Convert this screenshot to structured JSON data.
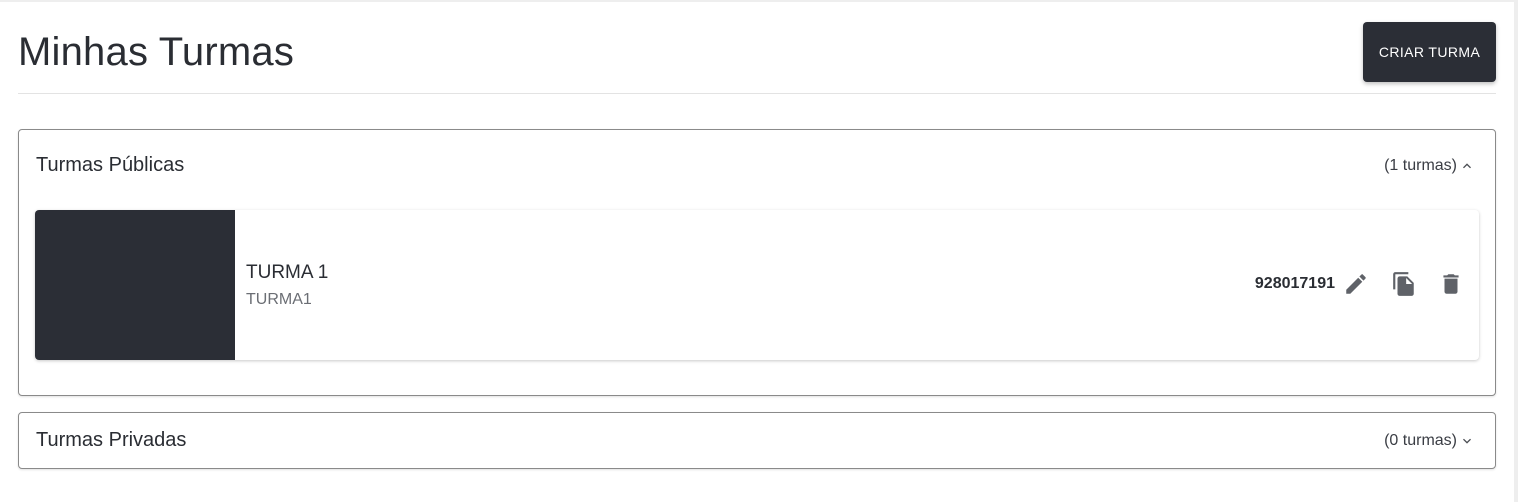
{
  "header": {
    "title": "Minhas Turmas",
    "create_button_label": "CRIAR TURMA"
  },
  "sections": [
    {
      "title": "Turmas Públicas",
      "count_label": "(1 turmas)",
      "expanded": true,
      "icon": "chevron-up-icon",
      "cards": [
        {
          "name": "TURMA 1",
          "subtitle": "TURMA1",
          "code": "928017191",
          "thumbnail_color": "#2b2e36",
          "actions": [
            "edit-icon",
            "copy-icon",
            "delete-icon"
          ]
        }
      ]
    },
    {
      "title": "Turmas Privadas",
      "count_label": "(0 turmas)",
      "expanded": false,
      "icon": "chevron-down-icon",
      "cards": []
    }
  ],
  "colors": {
    "primary_dark": "#2b2e36",
    "text": "#2a2d33",
    "muted": "#6b6e74",
    "border": "#8a8a8a"
  }
}
